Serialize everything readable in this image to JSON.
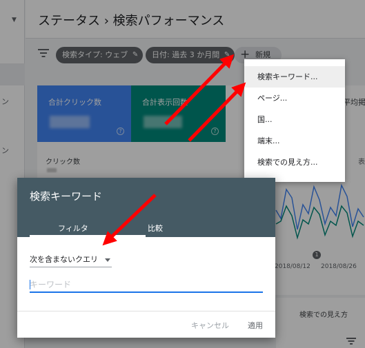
{
  "header": {
    "title": "ステータス  ›  検索パフォーマンス"
  },
  "filters": {
    "chips": [
      {
        "label": "検索タイプ: ウェブ"
      },
      {
        "label": "日付: 過去 3 か月間"
      }
    ],
    "new_button": "新規"
  },
  "cards": [
    {
      "title": "合計クリック数",
      "color": "#4285f4"
    },
    {
      "title": "合計表示回数",
      "color": "#00897b"
    },
    {
      "title": "平均掲載順",
      "color": "#ffffff"
    }
  ],
  "panel": {
    "clicks_label": "クリック数",
    "right_label": "表",
    "date_labels": [
      "2018/08/12",
      "2018/08/26"
    ],
    "marker": "1"
  },
  "bottom_card": {
    "label": "検索での見え方"
  },
  "dropdown_menu": {
    "items": [
      "検索キーワード...",
      "ページ...",
      "国...",
      "端末...",
      "検索での見え方..."
    ]
  },
  "dialog": {
    "title": "検索キーワード",
    "tabs": [
      "フィルタ",
      "比較"
    ],
    "select_value": "次を含まないクエリ",
    "input_placeholder": "キーワード",
    "input_value": "",
    "cancel": "キャンセル",
    "apply": "適用"
  },
  "colors": {
    "dialog_header": "#455a64",
    "accent": "#1a73e8",
    "annotation_arrow": "#ff0000"
  }
}
